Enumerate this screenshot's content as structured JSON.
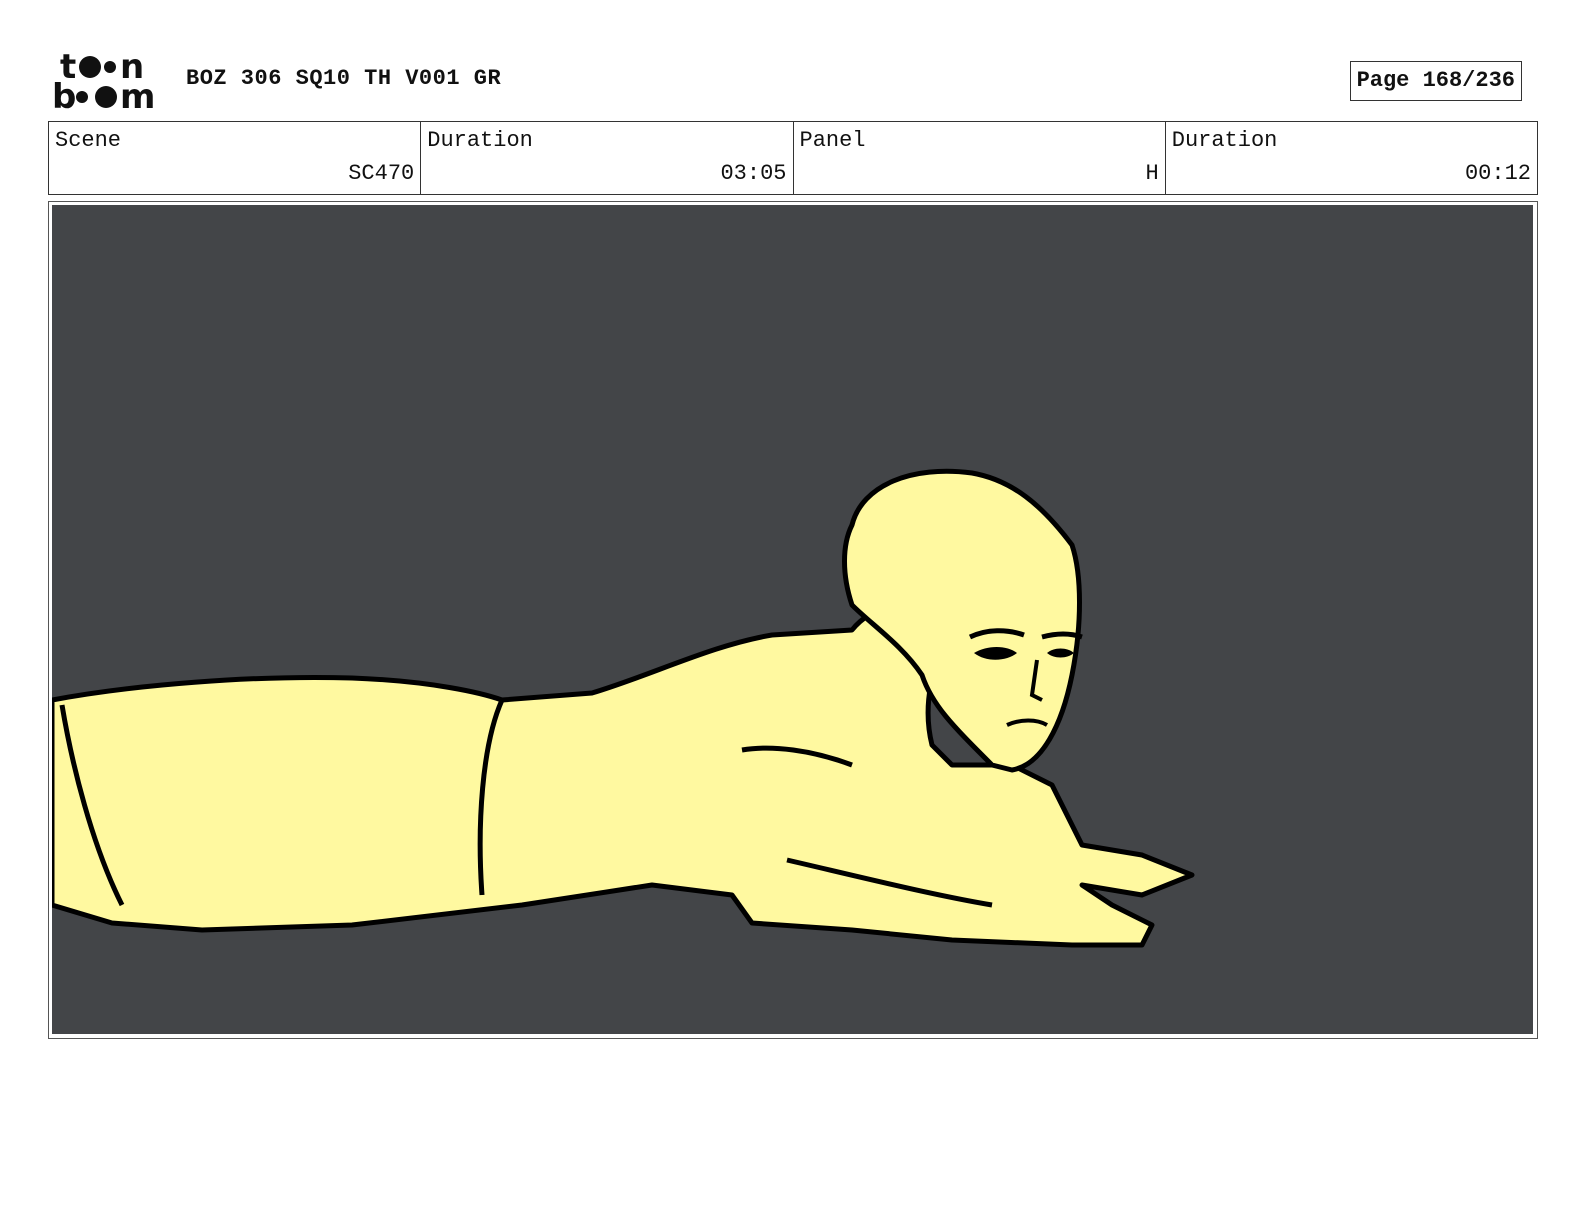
{
  "header": {
    "logo_text": "toonboom",
    "document_title": "BOZ 306 SQ10 TH V001 GR",
    "page_label": "Page 168/236"
  },
  "info": {
    "scene_label": "Scene",
    "scene_value": "SC470",
    "scene_duration_label": "Duration",
    "scene_duration_value": "03:05",
    "panel_label": "Panel",
    "panel_value": "H",
    "panel_duration_label": "Duration",
    "panel_duration_value": "00:12"
  },
  "panel": {
    "background_color": "#434548",
    "figure_fill": "#fff9a0",
    "line_color": "#000000"
  }
}
